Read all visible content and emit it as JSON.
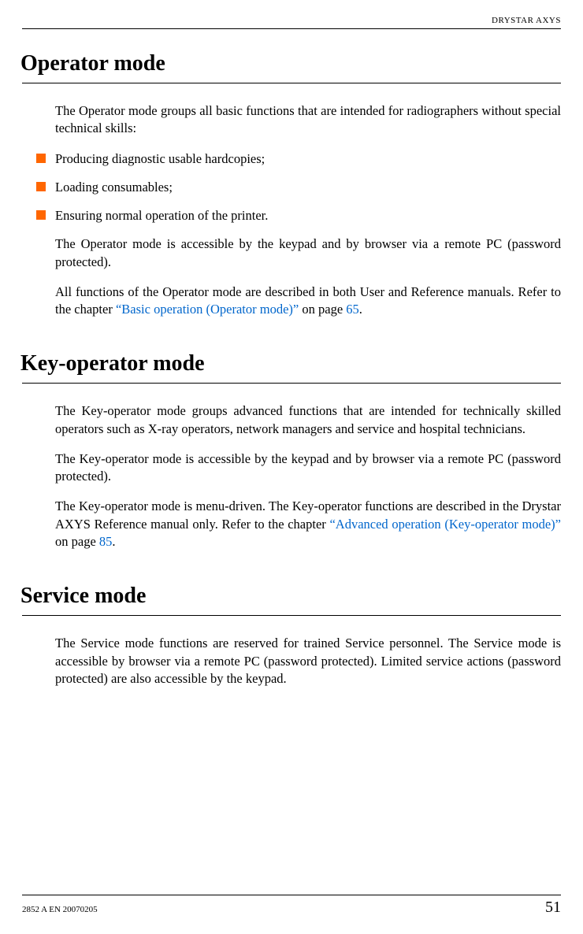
{
  "header": {
    "product": "DRYSTAR AXYS"
  },
  "sections": {
    "s1": {
      "title": "Operator mode",
      "p1": "The Operator mode groups all basic functions that are intended for radiographers without special technical skills:",
      "bullets": [
        "Producing diagnostic usable hardcopies;",
        "Loading consumables;",
        "Ensuring normal operation of the printer."
      ],
      "p2": "The Operator mode is accessible by the keypad and by browser via a remote PC (password protected).",
      "p3a": "All functions of the Operator mode are described in both User and Reference manuals. Refer to the chapter ",
      "p3link": "“Basic operation (Operator mode)”",
      "p3b": " on page ",
      "p3page": "65",
      "p3c": "."
    },
    "s2": {
      "title": "Key-operator mode",
      "p1": "The Key-operator mode groups advanced functions that are intended for technically skilled operators such as X-ray operators, network managers and service and hospital technicians.",
      "p2": "The Key-operator mode is accessible by the keypad and by browser via a remote PC (password protected).",
      "p3a": "The Key-operator mode is menu-driven. The Key-operator functions are described in the Drystar AXYS Reference manual only. Refer to the chapter ",
      "p3link": "“Advanced operation (Key-operator mode)”",
      "p3b": " on page ",
      "p3page": "85",
      "p3c": "."
    },
    "s3": {
      "title": "Service mode",
      "p1": "The Service mode functions are reserved for trained Service personnel. The Service mode is accessible by browser via a remote PC (password protected). Limited service actions (password protected) are also accessible by the keypad."
    }
  },
  "footer": {
    "doc_id": "2852 A EN 20070205",
    "page": "51"
  }
}
